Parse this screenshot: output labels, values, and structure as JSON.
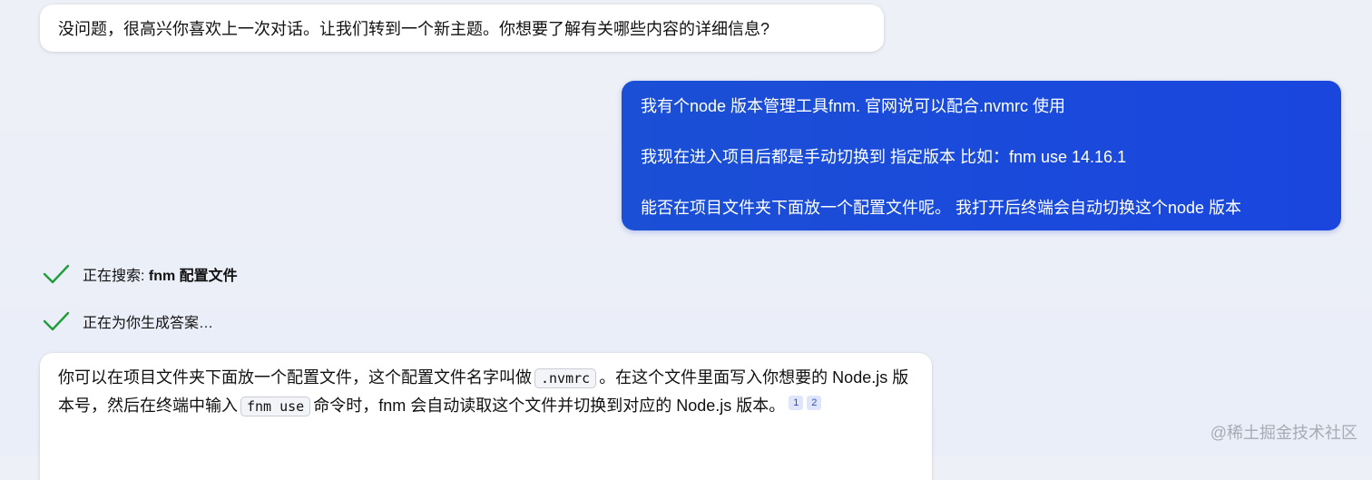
{
  "conversation": {
    "bot_message_1": "没问题，很高兴你喜欢上一次对话。让我们转到一个新主题。你想要了解有关哪些内容的详细信息?",
    "user_message_lines": [
      "我有个node 版本管理工具fnm. 官网说可以配合.nvmrc 使用",
      "我现在进入项目后都是手动切换到 指定版本  比如：fnm use 14.16.1",
      "能否在项目文件夹下面放一个配置文件呢。 我打开后终端会自动切换这个node 版本"
    ],
    "status_searching_prefix": "正在搜索: ",
    "status_searching_query": "fnm 配置文件",
    "status_generating": "正在为你生成答案…",
    "bot_message_2": {
      "part1": "你可以在项目文件夹下面放一个配置文件，这个配置文件名字叫做",
      "code1": ".nvmrc",
      "part2": "。在这个文件里面写入你想要的 Node.js 版本号，然后在终端中输入",
      "code2": "fnm use",
      "part3": "命令时，fnm 会自动读取这个文件并切换到对应的 Node.js 版本。",
      "citations": [
        "1",
        "2"
      ]
    }
  },
  "watermark": "@稀土掘金技术社区",
  "colors": {
    "user_bubble": "#1b4fd6",
    "check_green": "#1f9d3a",
    "citation_bg": "#dfe5fb"
  },
  "icons": {
    "status_done": "check-icon"
  }
}
